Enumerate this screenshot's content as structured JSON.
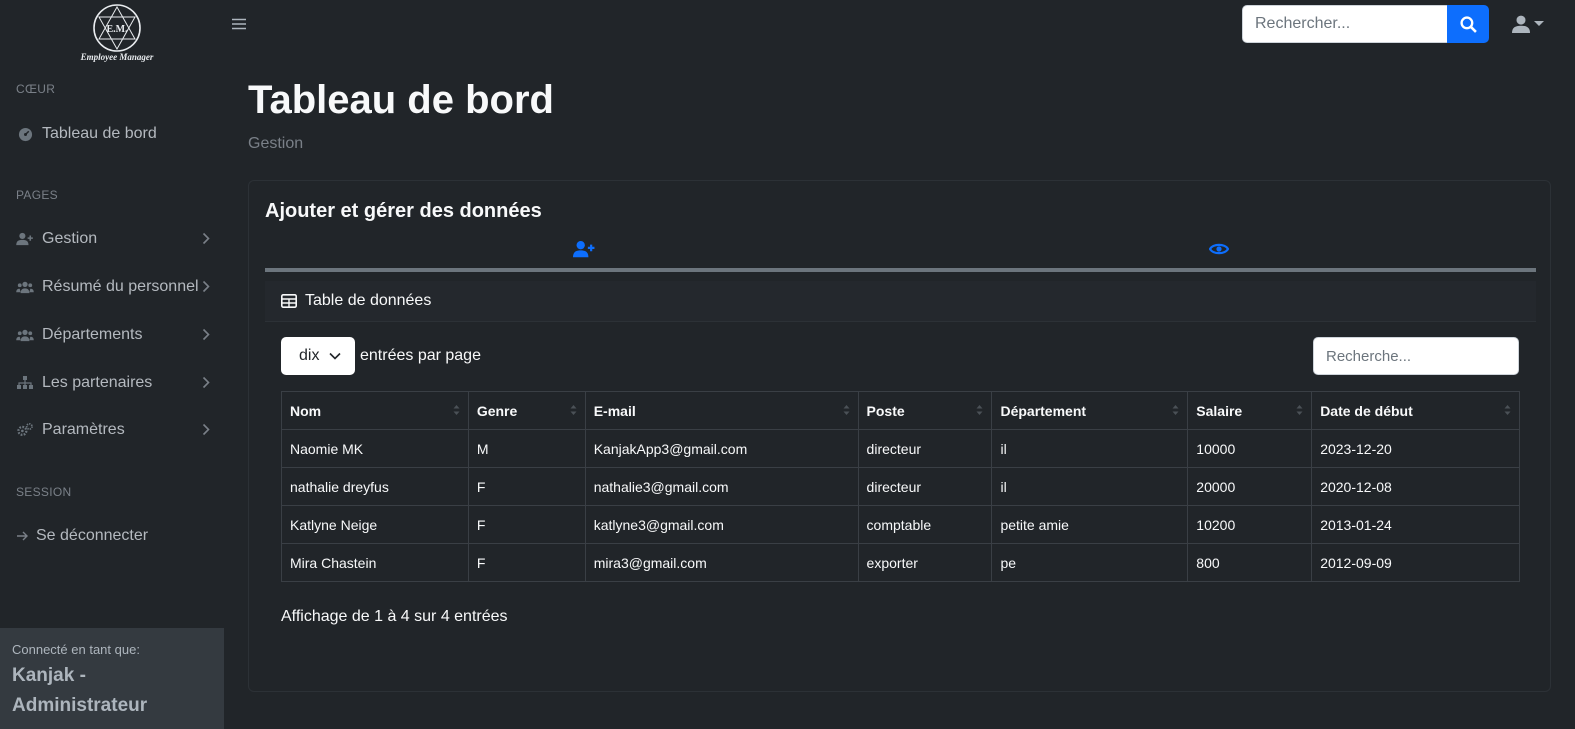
{
  "app": {
    "logo_initials": "E.M.",
    "logo_caption": "Employee Manager"
  },
  "colors": {
    "accent": "#0d6efd",
    "background": "#212529",
    "sidebar_footer": "#343a40"
  },
  "sidebar": {
    "sections": [
      {
        "heading": "CŒUR"
      },
      {
        "heading": "PAGES"
      },
      {
        "heading": "SESSION"
      }
    ],
    "items": [
      {
        "label": "Tableau de bord",
        "icon": "gauge-icon"
      },
      {
        "label": "Gestion",
        "icon": "user-plus-icon"
      },
      {
        "label": "Résumé du personnel",
        "icon": "users-icon"
      },
      {
        "label": "Départements",
        "icon": "users-icon"
      },
      {
        "label": "Les partenaires",
        "icon": "sitemap-icon"
      },
      {
        "label": "Paramètres",
        "icon": "cogs-icon"
      },
      {
        "label": "Se déconnecter",
        "icon": "arrow-right-icon"
      }
    ],
    "footer": {
      "caption": "Connecté en tant que:",
      "user": "Kanjak - Administrateur"
    }
  },
  "topbar": {
    "search_placeholder": "Rechercher..."
  },
  "main": {
    "title": "Tableau de bord",
    "breadcrumb": "Gestion",
    "card_title": "Ajouter et gérer des données",
    "tabs": [
      {
        "icon": "user-plus-icon"
      },
      {
        "icon": "eye-icon"
      }
    ],
    "datatable": {
      "header": "Table de données",
      "per_page_value": "dix",
      "per_page_label": "entrées par page",
      "search_placeholder": "Recherche...",
      "columns": [
        "Nom",
        "Genre",
        "E-mail",
        "Poste",
        "Département",
        "Salaire",
        "Date de début"
      ],
      "rows": [
        [
          "Naomie MK",
          "M",
          "KanjakApp3@gmail.com",
          "directeur",
          "il",
          "10000",
          "2023-12-20"
        ],
        [
          "nathalie dreyfus",
          "F",
          "nathalie3@gmail.com",
          "directeur",
          "il",
          "20000",
          "2020-12-08"
        ],
        [
          "Katlyne Neige",
          "F",
          "katlyne3@gmail.com",
          "comptable",
          "petite amie",
          "10200",
          "2013-01-24"
        ],
        [
          "Mira Chastein",
          "F",
          "mira3@gmail.com",
          "exporter",
          "pe",
          "800",
          "2012-09-09"
        ]
      ],
      "info": "Affichage de 1 à 4 sur 4 entrées"
    }
  }
}
